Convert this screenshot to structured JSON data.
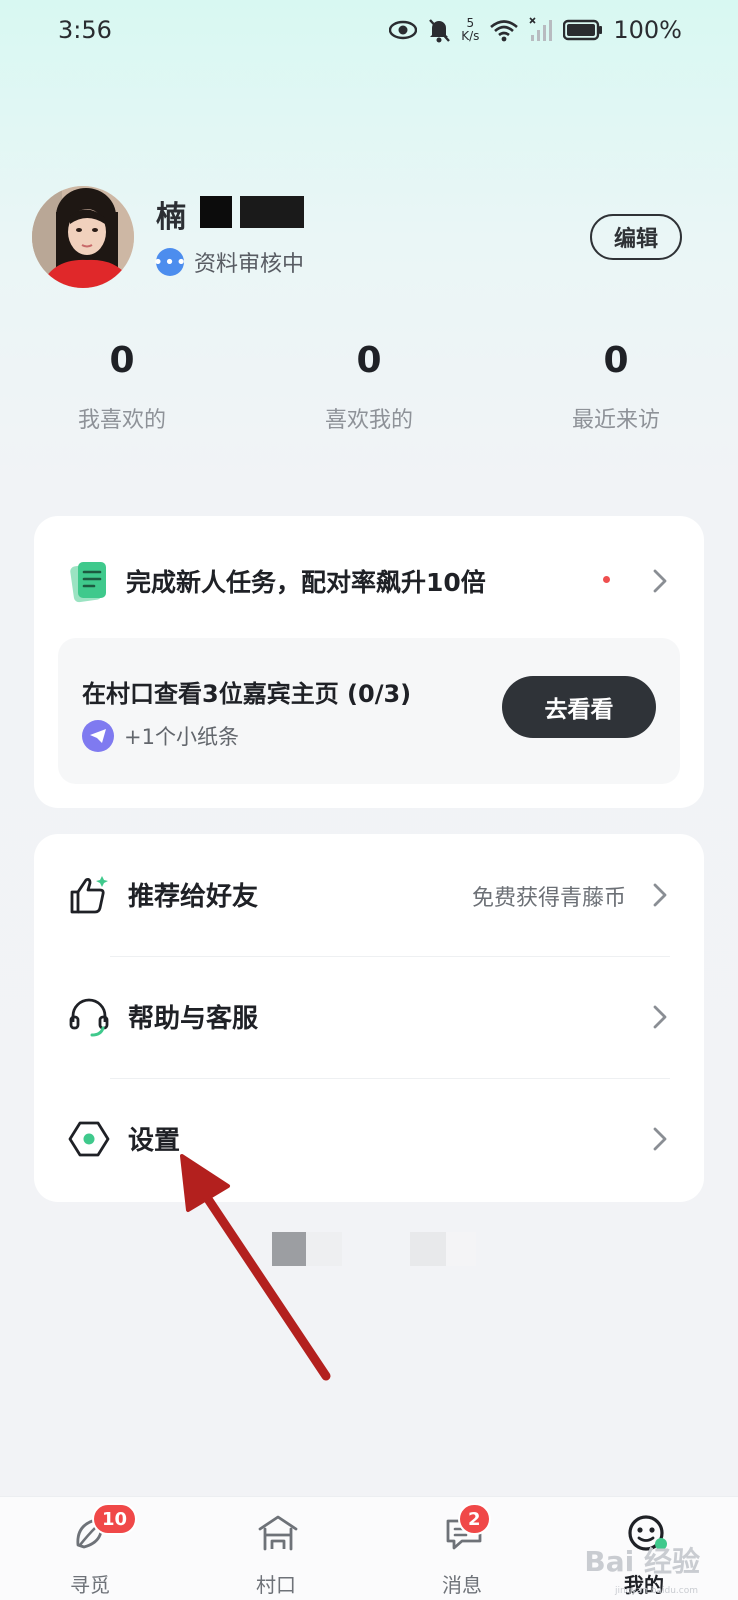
{
  "status_bar": {
    "time": "3:56",
    "net_speed_value": "5",
    "net_speed_unit": "K/s",
    "battery": "100%"
  },
  "profile": {
    "name_visible_prefix": "楠",
    "review_status": "资料审核中",
    "edit_label": "编辑"
  },
  "stats": [
    {
      "value": "0",
      "label": "我喜欢的"
    },
    {
      "value": "0",
      "label": "喜欢我的"
    },
    {
      "value": "0",
      "label": "最近来访"
    }
  ],
  "task_card": {
    "title": "完成新人任务，配对率飙升10倍",
    "task_title": "在村口查看3位嘉宾主页 (0/3)",
    "reward": "+1个小纸条",
    "go_label": "去看看"
  },
  "menu": [
    {
      "label": "推荐给好友",
      "extra": "免费获得青藤币",
      "icon": "thumbs-up-icon"
    },
    {
      "label": "帮助与客服",
      "extra": "",
      "icon": "headset-icon"
    },
    {
      "label": "设置",
      "extra": "",
      "icon": "settings-hexagon-icon"
    }
  ],
  "tabbar": [
    {
      "label": "寻觅",
      "badge": "10",
      "icon": "leaf-icon"
    },
    {
      "label": "村口",
      "badge": "",
      "icon": "village-gate-icon"
    },
    {
      "label": "消息",
      "badge": "2",
      "icon": "chat-bubble-icon"
    },
    {
      "label": "我的",
      "badge": "",
      "icon": "profile-face-icon",
      "active": true
    }
  ],
  "watermark": {
    "main": "Bai 经验",
    "sub": "jingyan.baidu.com"
  },
  "colors": {
    "accent_green": "#3fc98c",
    "badge_red": "#f04848",
    "dark_button": "#2f3338",
    "arrow_red": "#b3201e"
  }
}
